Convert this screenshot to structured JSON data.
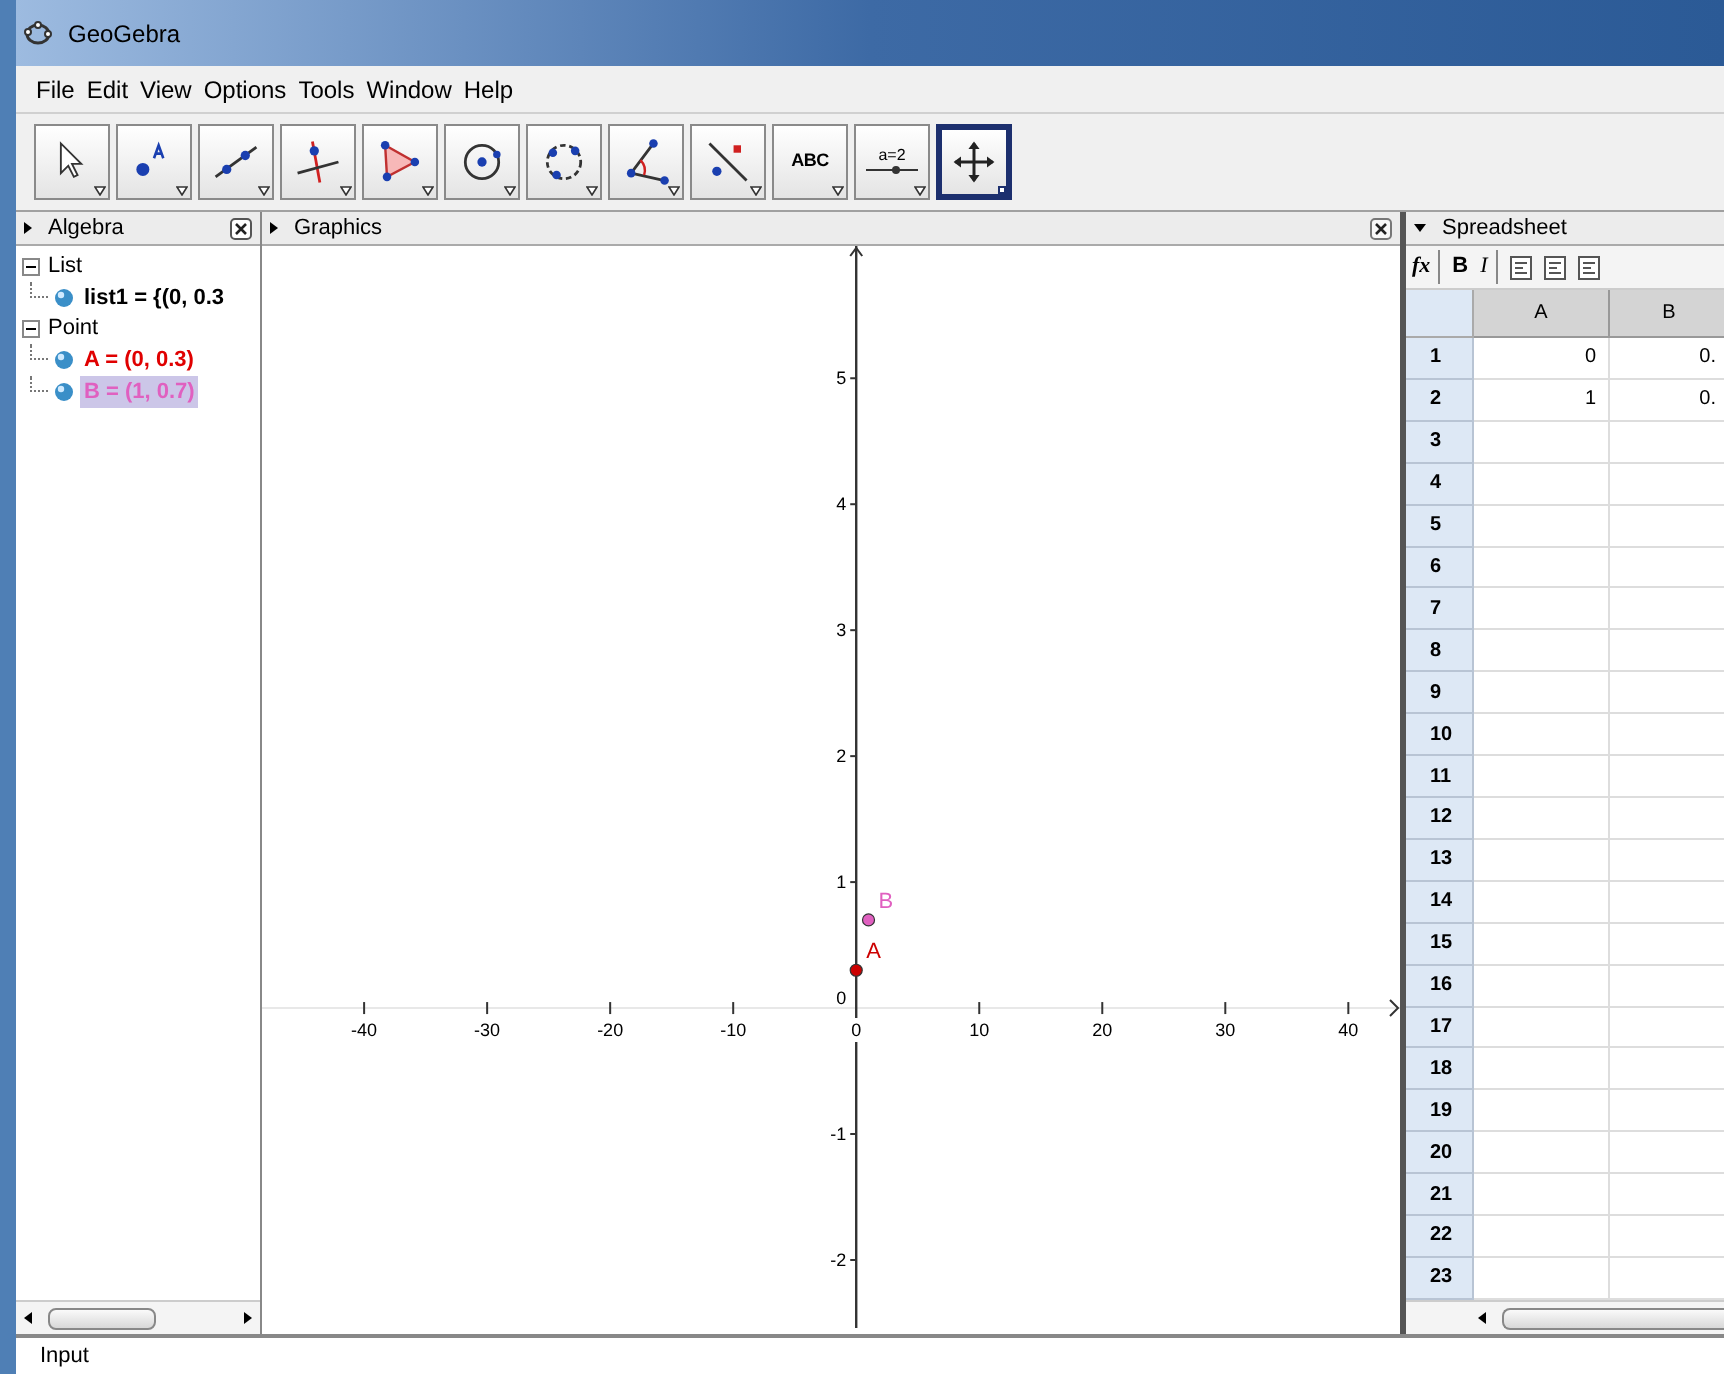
{
  "window": {
    "title": "GeoGebra"
  },
  "menu": [
    "File",
    "Edit",
    "View",
    "Options",
    "Tools",
    "Window",
    "Help"
  ],
  "toolbar": [
    {
      "kind": "pointer",
      "selected": false
    },
    {
      "kind": "point",
      "selected": false
    },
    {
      "kind": "line",
      "selected": false
    },
    {
      "kind": "perpendicular",
      "selected": false
    },
    {
      "kind": "polygon",
      "selected": false
    },
    {
      "kind": "circle",
      "selected": false
    },
    {
      "kind": "conic",
      "selected": false
    },
    {
      "kind": "angle",
      "selected": false
    },
    {
      "kind": "reflect",
      "selected": false
    },
    {
      "kind": "text",
      "label": "ABC",
      "selected": false
    },
    {
      "kind": "slider",
      "label": "a=2",
      "selected": false
    },
    {
      "kind": "move-view",
      "selected": true
    }
  ],
  "algebra": {
    "title": "Algebra",
    "tree": [
      {
        "label": "List",
        "expanded": true,
        "children": [
          {
            "label": "list1 = {(0, 0.3",
            "color": "#000000",
            "selected": false
          }
        ]
      },
      {
        "label": "Point",
        "expanded": true,
        "children": [
          {
            "label": "A = (0, 0.3)",
            "color": "#e00000",
            "selected": false
          },
          {
            "label": "B = (1, 0.7)",
            "color": "#e060c0",
            "selected": true
          }
        ]
      }
    ]
  },
  "graphics": {
    "title": "Graphics",
    "chart_data": {
      "type": "scatter",
      "x": [
        0,
        1
      ],
      "series": [
        {
          "name": "A",
          "color": "#cc0000",
          "values": [
            0.3,
            null
          ]
        },
        {
          "name": "B",
          "color": "#e060c0",
          "values": [
            null,
            0.7
          ]
        }
      ],
      "xlim": [
        -48.3,
        44.2
      ],
      "ylim": [
        -2.54,
        6.05
      ],
      "xticks": [
        -40,
        -30,
        -20,
        -10,
        0,
        10,
        20,
        30,
        40
      ],
      "yticks": [
        -2,
        -1,
        0,
        1,
        2,
        3,
        4,
        5
      ]
    }
  },
  "spreadsheet": {
    "title": "Spreadsheet",
    "formula_label": "fx",
    "format_buttons": [
      "B",
      "I"
    ],
    "columns": [
      "A",
      "B"
    ],
    "rows": [
      {
        "number": "1",
        "cells": [
          "0",
          "0."
        ]
      },
      {
        "number": "2",
        "cells": [
          "1",
          "0."
        ]
      },
      {
        "number": "3"
      },
      {
        "number": "4"
      },
      {
        "number": "5"
      },
      {
        "number": "6"
      },
      {
        "number": "7"
      },
      {
        "number": "8"
      },
      {
        "number": "9"
      },
      {
        "number": "10"
      },
      {
        "number": "11"
      },
      {
        "number": "12"
      },
      {
        "number": "13"
      },
      {
        "number": "14"
      },
      {
        "number": "15"
      },
      {
        "number": "16"
      },
      {
        "number": "17"
      },
      {
        "number": "18"
      },
      {
        "number": "19"
      },
      {
        "number": "20"
      },
      {
        "number": "21"
      },
      {
        "number": "22"
      },
      {
        "number": "23"
      }
    ]
  },
  "input_bar": {
    "label": "Input"
  }
}
